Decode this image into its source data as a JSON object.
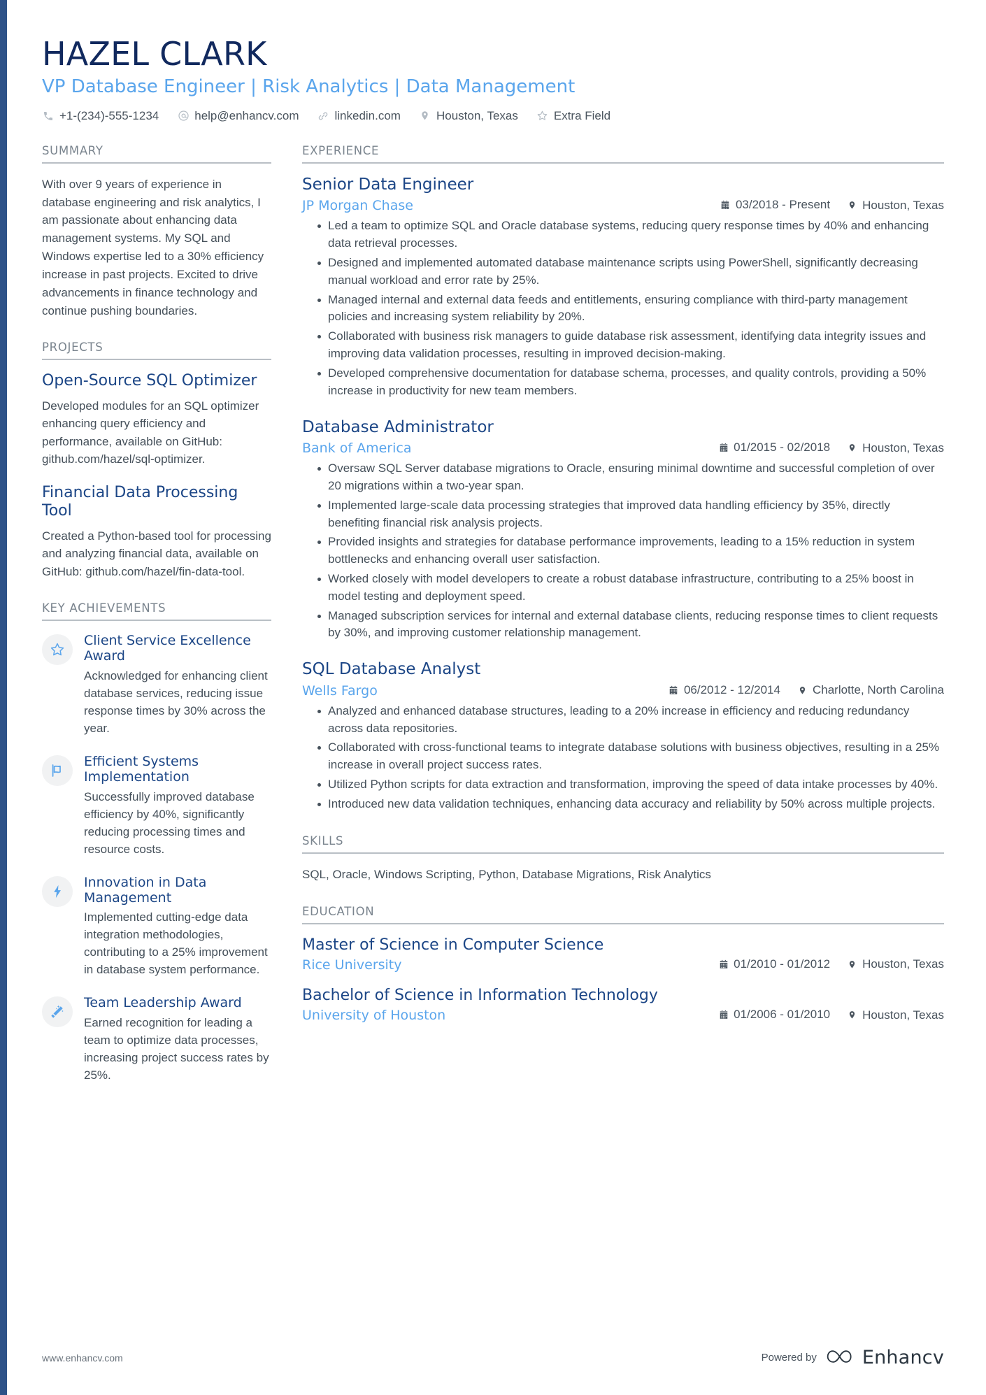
{
  "header": {
    "name": "HAZEL CLARK",
    "headline": "VP Database Engineer | Risk Analytics | Data Management",
    "contacts": [
      {
        "icon": "phone-icon",
        "text": "+1-(234)-555-1234"
      },
      {
        "icon": "email-icon",
        "text": "help@enhancv.com"
      },
      {
        "icon": "link-icon",
        "text": "linkedin.com"
      },
      {
        "icon": "location-pin-icon",
        "text": "Houston, Texas"
      },
      {
        "icon": "star-icon",
        "text": "Extra Field"
      }
    ]
  },
  "sidebar": {
    "summary": {
      "title": "SUMMARY",
      "text": "With over 9 years of experience in database engineering and risk analytics, I am passionate about enhancing data management systems. My SQL and Windows expertise led to a 30% efficiency increase in past projects. Excited to drive advancements in finance technology and continue pushing boundaries."
    },
    "projects": {
      "title": "PROJECTS",
      "items": [
        {
          "name": "Open-Source SQL Optimizer",
          "description": "Developed modules for an SQL optimizer enhancing query efficiency and performance, available on GitHub: github.com/hazel/sql-optimizer."
        },
        {
          "name": "Financial Data Processing Tool",
          "description": "Created a Python-based tool for processing and analyzing financial data, available on GitHub: github.com/hazel/fin-data-tool."
        }
      ]
    },
    "achievements": {
      "title": "KEY ACHIEVEMENTS",
      "items": [
        {
          "icon": "star-outline-icon",
          "title": "Client Service Excellence Award",
          "description": "Acknowledged for enhancing client database services, reducing issue response times by 30% across the year."
        },
        {
          "icon": "flag-icon",
          "title": "Efficient Systems Implementation",
          "description": "Successfully improved database efficiency by 40%, significantly reducing processing times and resource costs."
        },
        {
          "icon": "lightning-bolt-icon",
          "title": "Innovation in Data Management",
          "description": "Implemented cutting-edge data integration methodologies, contributing to a 25% improvement in database system performance."
        },
        {
          "icon": "magic-wand-icon",
          "title": "Team Leadership Award",
          "description": "Earned recognition for leading a team to optimize data processes, increasing project success rates by 25%."
        }
      ]
    }
  },
  "main": {
    "experience": {
      "title": "EXPERIENCE",
      "jobs": [
        {
          "position": "Senior Data Engineer",
          "company": "JP Morgan Chase",
          "dates": "03/2018 - Present",
          "location": "Houston, Texas",
          "bullets": [
            "Led a team to optimize SQL and Oracle database systems, reducing query response times by 40% and enhancing data retrieval processes.",
            "Designed and implemented automated database maintenance scripts using PowerShell, significantly decreasing manual workload and error rate by 25%.",
            "Managed internal and external data feeds and entitlements, ensuring compliance with third-party management policies and increasing system reliability by 20%.",
            "Collaborated with business risk managers to guide database risk assessment, identifying data integrity issues and improving data validation processes, resulting in improved decision-making.",
            "Developed comprehensive documentation for database schema, processes, and quality controls, providing a 50% increase in productivity for new team members."
          ]
        },
        {
          "position": "Database Administrator",
          "company": "Bank of America",
          "dates": "01/2015 - 02/2018",
          "location": "Houston, Texas",
          "bullets": [
            "Oversaw SQL Server database migrations to Oracle, ensuring minimal downtime and successful completion of over 20 migrations within a two-year span.",
            "Implemented large-scale data processing strategies that improved data handling efficiency by 35%, directly benefiting financial risk analysis projects.",
            "Provided insights and strategies for database performance improvements, leading to a 15% reduction in system bottlenecks and enhancing overall user satisfaction.",
            "Worked closely with model developers to create a robust database infrastructure, contributing to a 25% boost in model testing and deployment speed.",
            "Managed subscription services for internal and external database clients, reducing response times to client requests by 30%, and improving customer relationship management."
          ]
        },
        {
          "position": "SQL Database Analyst",
          "company": "Wells Fargo",
          "dates": "06/2012 - 12/2014",
          "location": "Charlotte, North Carolina",
          "bullets": [
            "Analyzed and enhanced database structures, leading to a 20% increase in efficiency and reducing redundancy across data repositories.",
            "Collaborated with cross-functional teams to integrate database solutions with business objectives, resulting in a 25% increase in overall project success rates.",
            "Utilized Python scripts for data extraction and transformation, improving the speed of data intake processes by 40%.",
            "Introduced new data validation techniques, enhancing data accuracy and reliability by 50% across multiple projects."
          ]
        }
      ]
    },
    "skills": {
      "title": "SKILLS",
      "text": "SQL, Oracle, Windows Scripting, Python, Database Migrations, Risk Analytics"
    },
    "education": {
      "title": "EDUCATION",
      "items": [
        {
          "degree": "Master of Science in Computer Science",
          "school": "Rice University",
          "dates": "01/2010 - 01/2012",
          "location": "Houston, Texas"
        },
        {
          "degree": "Bachelor of Science in Information Technology",
          "school": "University of Houston",
          "dates": "01/2006 - 01/2010",
          "location": "Houston, Texas"
        }
      ]
    }
  },
  "footer": {
    "website": "www.enhancv.com",
    "powered_by": "Powered by",
    "brand": "Enhancv"
  },
  "colors": {
    "accent_bar": "#2e5288",
    "name": "#11295e",
    "headline": "#5aa5ec",
    "heading": "#1c4686",
    "company": "#5aa5ec",
    "section_label": "#7a848e",
    "body": "#45505a",
    "badge_bg": "#f1f2f3",
    "icon_blue": "#5aa5ec"
  }
}
